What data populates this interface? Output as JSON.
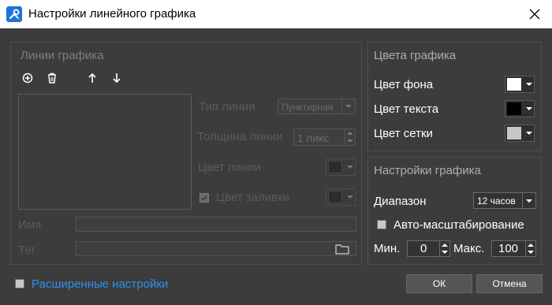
{
  "window": {
    "title": "Настройки линейного графика"
  },
  "lines_panel": {
    "title": "Линии графика",
    "line_type_label": "Тип линии",
    "line_type_value": "Пунктирная",
    "thickness_label": "Толщина линии",
    "thickness_value": "1 пикс",
    "line_color_label": "Цвет линии",
    "fill_color_label": "Цвет заливки",
    "name_label": "Имя",
    "name_value": "",
    "tag_label": "Тег",
    "tag_value": ""
  },
  "colors_panel": {
    "title": "Цвета графика",
    "bg_label": "Цвет фона",
    "bg_color": "#ffffff",
    "text_label": "Цвет текста",
    "text_color": "#000000",
    "grid_label": "Цвет сетки",
    "grid_color": "#c8c8c8"
  },
  "settings_panel": {
    "title": "Настройки графика",
    "range_label": "Диапазон",
    "range_value": "12 часов",
    "autoscale_label": "Авто-масштабирование",
    "min_label": "Мин.",
    "min_value": "0",
    "max_label": "Макс.",
    "max_value": "100"
  },
  "footer": {
    "advanced_label": "Расширенные настройки",
    "ok_label": "ОК",
    "cancel_label": "Отмена"
  },
  "colors": {
    "accent": "#2f8ff0",
    "background": "#3c3c3c"
  }
}
